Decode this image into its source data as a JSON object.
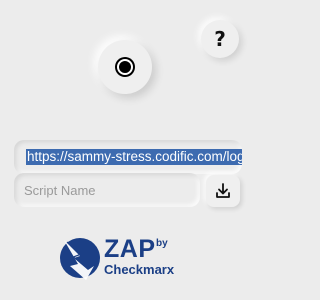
{
  "help": {
    "label": "?"
  },
  "recorder": {
    "icon": "record-icon"
  },
  "url": {
    "value": "https://sammy-stress.codific.com/login"
  },
  "script": {
    "placeholder": "Script Name",
    "value": ""
  },
  "save": {
    "icon": "download-icon"
  },
  "branding": {
    "zap": "ZAP",
    "by": "by",
    "vendor": "Checkmarx"
  },
  "colors": {
    "accent": "#3d6bb0",
    "brand": "#1b3f86",
    "background": "#ececec"
  }
}
